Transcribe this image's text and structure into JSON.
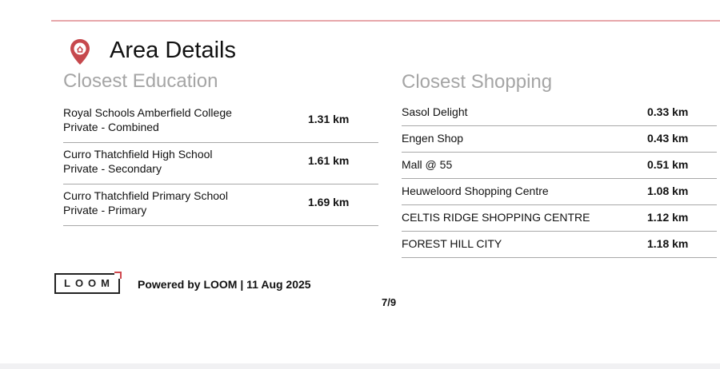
{
  "header": {
    "title": "Area Details"
  },
  "education": {
    "heading": "Closest Education",
    "items": [
      {
        "name": "Royal Schools Amberfield College",
        "type": "Private - Combined",
        "distance": "1.31 km"
      },
      {
        "name": "Curro Thatchfield High School",
        "type": "Private - Secondary",
        "distance": "1.61 km"
      },
      {
        "name": "Curro Thatchfield Primary School",
        "type": "Private - Primary",
        "distance": "1.69 km"
      }
    ]
  },
  "shopping": {
    "heading": "Closest Shopping",
    "items": [
      {
        "name": "Sasol Delight",
        "distance": "0.33 km"
      },
      {
        "name": "Engen Shop",
        "distance": "0.43 km"
      },
      {
        "name": "Mall @ 55",
        "distance": "0.51 km"
      },
      {
        "name": "Heuweloord Shopping Centre",
        "distance": "1.08 km"
      },
      {
        "name": "CELTIS RIDGE SHOPPING CENTRE",
        "distance": "1.12 km"
      },
      {
        "name": "FOREST HILL CITY",
        "distance": "1.18 km"
      }
    ]
  },
  "footer": {
    "logo_text": "LOOM",
    "powered_by": "Powered by LOOM | 11 Aug 2025",
    "page_number": "7/9"
  },
  "colors": {
    "accent": "#d0484e",
    "heading_gray": "#a5a5a5",
    "divider": "#a8a8a8"
  },
  "icons": {
    "title_icon": "location-pin-icon"
  }
}
